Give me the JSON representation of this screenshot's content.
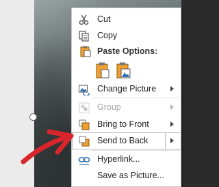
{
  "menu": {
    "cut": "Cut",
    "copy": "Copy",
    "paste_options": "Paste Options:",
    "change_picture": "Change Picture",
    "group": "Group",
    "bring_to_front": "Bring to Front",
    "send_to_back": "Send to Back",
    "hyperlink": "Hyperlink...",
    "save_as_picture": "Save as Picture..."
  },
  "colors": {
    "annotation_arrow": "#d9262c",
    "icon_orange": "#f0a030",
    "icon_blue": "#2f6fb3"
  }
}
